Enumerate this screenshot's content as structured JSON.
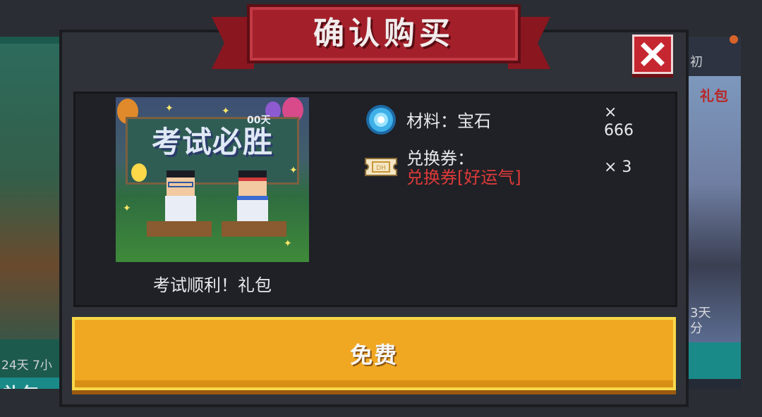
{
  "dialog": {
    "title": "确认购买",
    "close_icon": "close-icon",
    "gift": {
      "image_headline": "考试必胜",
      "image_tag": "00天",
      "name": "考试顺利！礼包"
    },
    "rewards": [
      {
        "icon": "gem-icon",
        "label": "材料：宝石",
        "qty": "×\n666"
      },
      {
        "icon": "ticket-icon",
        "label": "兑换券：",
        "detail": "兑换券[好运气]",
        "qty": "× 3"
      }
    ],
    "free_button": "免费"
  },
  "background": {
    "left_card": {
      "meta": "24天 7小",
      "tag": "礼包"
    },
    "right_card": {
      "header": "初",
      "art_label": "礼包",
      "meta_line1": "3天",
      "meta_line2": "分"
    }
  },
  "colors": {
    "ribbon_red": "#a3202b",
    "close_red": "#c62630",
    "button_yellow": "#f0a822",
    "highlight_red": "#e03a3a",
    "gem_blue": "#3fb0e8"
  }
}
